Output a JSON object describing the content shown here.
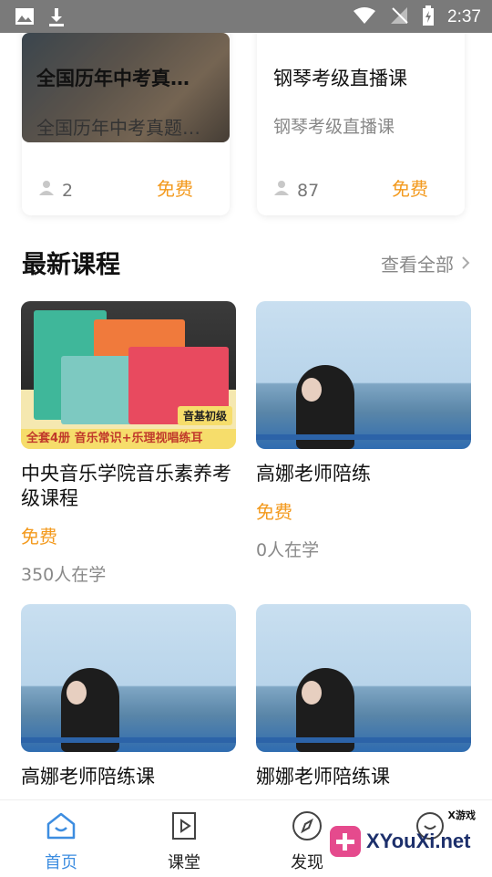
{
  "status_bar": {
    "time": "2:37"
  },
  "prev_cards": [
    {
      "title": "全国历年中考真…",
      "subtitle": "全国历年中考真题…",
      "count": "2",
      "price": "免费"
    },
    {
      "title": "钢琴考级直播课",
      "subtitle": "钢琴考级直播课",
      "count": "87",
      "price": "免费"
    }
  ],
  "section": {
    "title": "最新课程",
    "see_all": "查看全部"
  },
  "courses": [
    {
      "name": "中央音乐学院音乐素养考级课程",
      "price": "免费",
      "learners": "350人在学",
      "banner": "全套4册  音乐常识+乐理视唱练耳",
      "tag": "音基初级"
    },
    {
      "name": "高娜老师陪练",
      "price": "免费",
      "learners": "0人在学"
    },
    {
      "name": "高娜老师陪练课"
    },
    {
      "name": "娜娜老师陪练课"
    }
  ],
  "tabs": [
    {
      "label": "首页",
      "icon": "home-icon",
      "active": true
    },
    {
      "label": "课堂",
      "icon": "play-book-icon",
      "active": false
    },
    {
      "label": "发现",
      "icon": "compass-icon",
      "active": false
    }
  ],
  "watermark": {
    "brand": "XYouXi.net",
    "small": "X游戏"
  },
  "colors": {
    "accent": "#3d8de0",
    "price": "#f39a1e"
  }
}
